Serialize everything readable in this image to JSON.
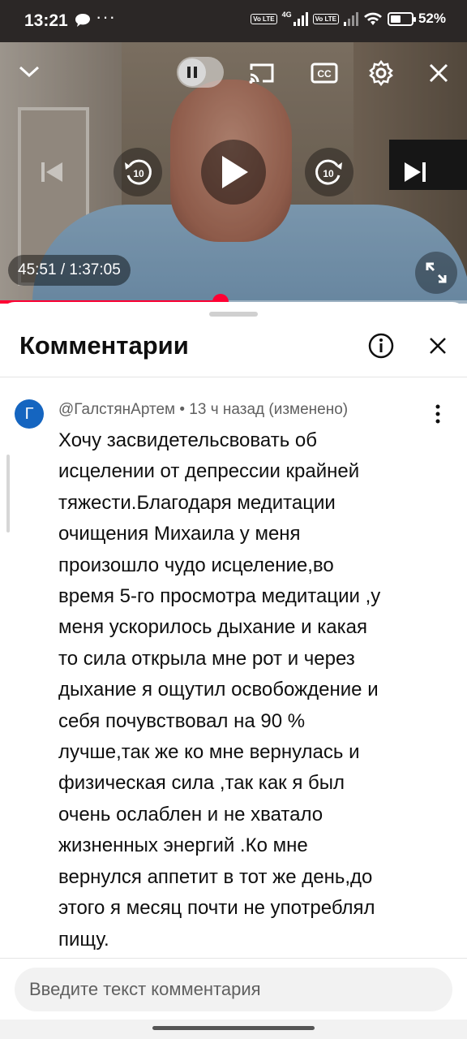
{
  "status_bar": {
    "time": "13:21",
    "dots": "···",
    "volte1": "Vo LTE",
    "network": "4G",
    "volte2": "Vo LTE",
    "battery_percent": "52%",
    "battery_level": 0.52,
    "icons": [
      "chat-icon",
      "signal-icon",
      "wifi-icon",
      "battery-icon"
    ]
  },
  "player": {
    "time_display": "45:51 / 1:37:05",
    "progress_fraction": 0.472,
    "accent": "#ff0033",
    "icons": [
      "chevron-down-icon",
      "pause-icon",
      "cast-icon",
      "cc-icon",
      "settings-icon",
      "close-icon",
      "previous-icon",
      "replay-10-icon",
      "play-icon",
      "forward-10-icon",
      "next-icon",
      "fullscreen-icon"
    ],
    "skip_label": "10"
  },
  "comments": {
    "title": "Комментарии",
    "comment": {
      "avatar_letter": "Г",
      "avatar_color": "#1565c0",
      "meta": "@ГалстянАртем • 13 ч назад (изменено)",
      "text": "Хочу засвидетельсвовать  об\nисцелении от депрессии крайней\nтяжести.Благодаря медитации\nочищения Михаила у меня\nпроизошло чудо исцеление,во\nвремя 5-го просмотра медитации ,у\nменя ускорилось дыхание и какая\nто сила открыла мне рот и через\nдыхание я ощутил освобождение и\nсебя почувствовал на 90 %\nлучше,так же ко мне вернулась и\nфизическая сила ,так как я был\nочень ослаблен и не хватало\nжизненных энергий .Ко мне\nвернулся аппетит в тот же день,до\nэтого я месяц почти не употреблял\nпищу."
    },
    "input_placeholder": "Введите текст комментария"
  }
}
